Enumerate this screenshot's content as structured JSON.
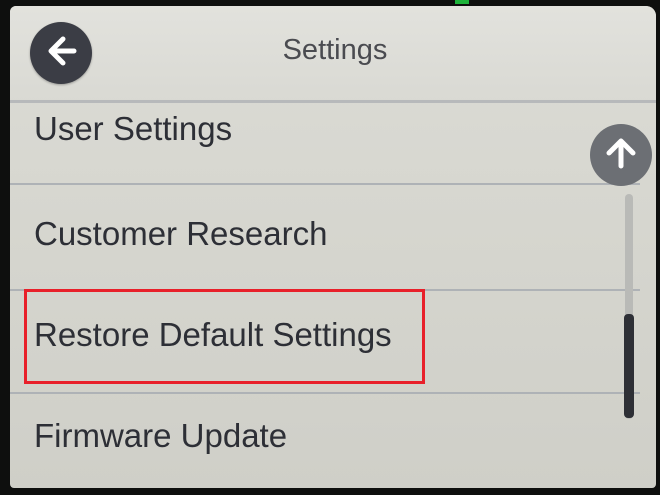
{
  "header": {
    "title": "Settings",
    "back_icon": "arrow-left-icon"
  },
  "menu": {
    "items": [
      {
        "label": "User Settings"
      },
      {
        "label": "Customer Research"
      },
      {
        "label": "Restore Default Settings",
        "highlighted": true
      },
      {
        "label": "Firmware Update"
      }
    ]
  },
  "scroll": {
    "up_icon": "arrow-up-icon"
  },
  "colors": {
    "highlight": "#e8202a",
    "button": "#3b3d45",
    "screen_bg": "#d8d8d2"
  }
}
